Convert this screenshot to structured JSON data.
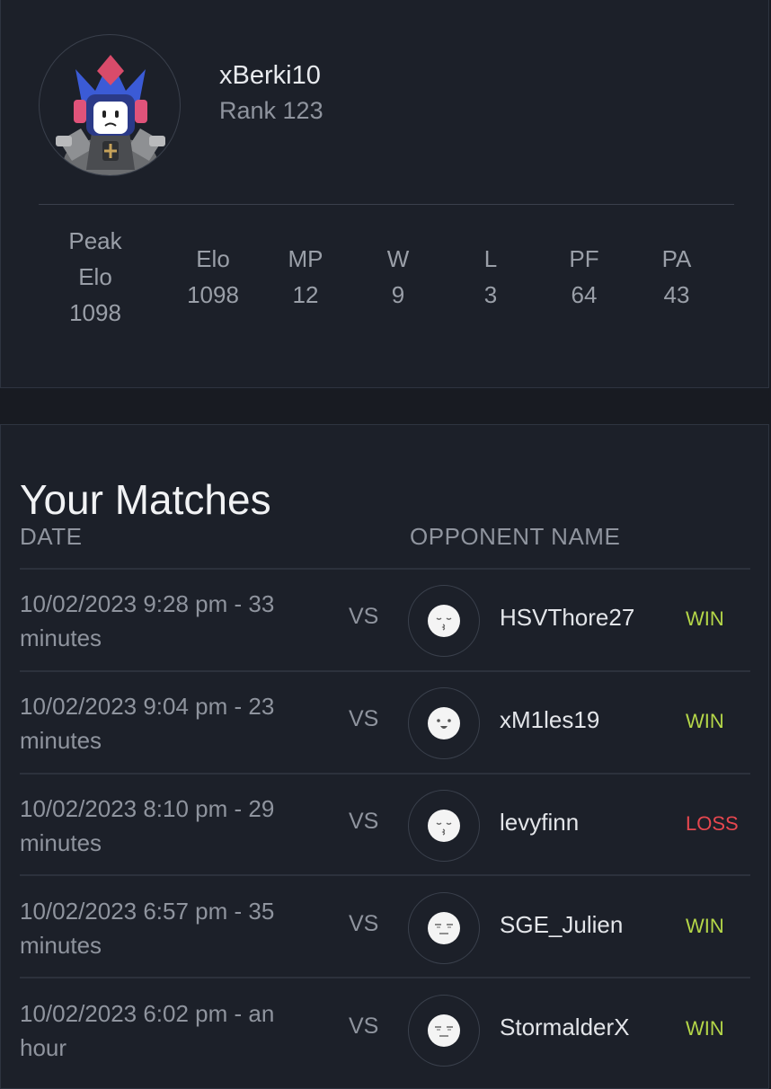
{
  "profile": {
    "username": "xBerki10",
    "rank": "Rank 123",
    "stats": [
      {
        "label_lines": [
          "Peak",
          "Elo"
        ],
        "value": "1098"
      },
      {
        "label_lines": [
          "Elo"
        ],
        "value": "1098"
      },
      {
        "label_lines": [
          "MP"
        ],
        "value": "12"
      },
      {
        "label_lines": [
          "W"
        ],
        "value": "9"
      },
      {
        "label_lines": [
          "L"
        ],
        "value": "3"
      },
      {
        "label_lines": [
          "PF"
        ],
        "value": "64"
      },
      {
        "label_lines": [
          "PA"
        ],
        "value": "43"
      }
    ]
  },
  "matches": {
    "title": "Your Matches",
    "columns": {
      "date": "DATE",
      "opponent": "OPPONENT NAME"
    },
    "vs_label": "VS",
    "rows": [
      {
        "date_line1": "10/02/2023 9:28 pm - 33",
        "date_line2": "minutes",
        "opponent": "HSVThore27",
        "result": "WIN",
        "face": "kiss-face-icon"
      },
      {
        "date_line1": "10/02/2023 9:04 pm - 23",
        "date_line2": "minutes",
        "opponent": "xM1les19",
        "result": "WIN",
        "face": "happy-face-icon"
      },
      {
        "date_line1": "10/02/2023 8:10 pm - 29",
        "date_line2": "minutes",
        "opponent": "levyfinn",
        "result": "LOSS",
        "face": "kiss-face-icon"
      },
      {
        "date_line1": "10/02/2023 6:57 pm - 35",
        "date_line2": "minutes",
        "opponent": "SGE_Julien",
        "result": "WIN",
        "face": "neutral-face-icon"
      },
      {
        "date_line1": "10/02/2023 6:02 pm - an",
        "date_line2": "hour",
        "opponent": "StormalderX",
        "result": "WIN",
        "face": "neutral-face-icon"
      }
    ]
  },
  "colors": {
    "win": "#b4d648",
    "loss": "#e6474f",
    "background": "#181b22",
    "card": "#1c2029"
  }
}
